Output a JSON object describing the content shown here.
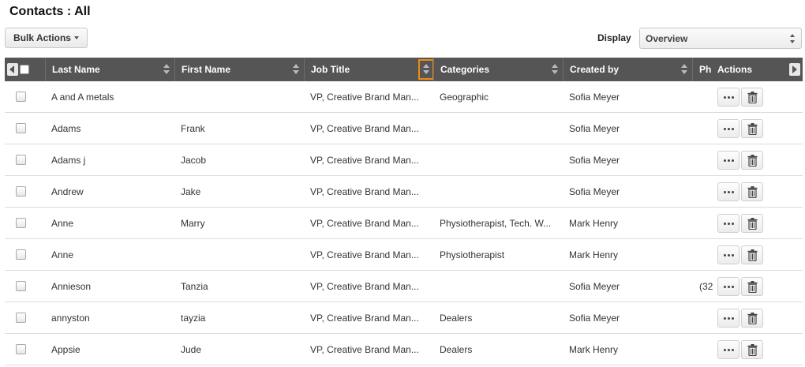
{
  "page": {
    "title": "Contacts : All"
  },
  "toolbar": {
    "bulk_actions_label": "Bulk Actions",
    "display_label": "Display",
    "display_value": "Overview"
  },
  "table": {
    "columns": [
      {
        "key": "last_name",
        "label": "Last Name"
      },
      {
        "key": "first_name",
        "label": "First Name"
      },
      {
        "key": "job_title",
        "label": "Job Title"
      },
      {
        "key": "categories",
        "label": "Categories"
      },
      {
        "key": "created_by",
        "label": "Created by"
      },
      {
        "key": "phone",
        "label": "Ph"
      },
      {
        "key": "actions",
        "label": "Actions"
      }
    ],
    "rows": [
      {
        "last_name": "A and A metals",
        "first_name": "",
        "job_title": "VP, Creative Brand Man...",
        "categories": "Geographic",
        "created_by": "Sofia Meyer",
        "phone": ""
      },
      {
        "last_name": "Adams",
        "first_name": "Frank",
        "job_title": "VP, Creative Brand Man...",
        "categories": "",
        "created_by": "Sofia Meyer",
        "phone": ""
      },
      {
        "last_name": "Adams j",
        "first_name": "Jacob",
        "job_title": "VP, Creative Brand Man...",
        "categories": "",
        "created_by": "Sofia Meyer",
        "phone": ""
      },
      {
        "last_name": "Andrew",
        "first_name": "Jake",
        "job_title": "VP, Creative Brand Man...",
        "categories": "",
        "created_by": "Sofia Meyer",
        "phone": ""
      },
      {
        "last_name": "Anne",
        "first_name": "Marry",
        "job_title": "VP, Creative Brand Man...",
        "categories": "Physiotherapist, Tech. W...",
        "created_by": "Mark Henry",
        "phone": ""
      },
      {
        "last_name": "Anne",
        "first_name": "",
        "job_title": "VP, Creative Brand Man...",
        "categories": "Physiotherapist",
        "created_by": "Mark Henry",
        "phone": ""
      },
      {
        "last_name": "Annieson",
        "first_name": "Tanzia",
        "job_title": "VP, Creative Brand Man...",
        "categories": "",
        "created_by": "Sofia Meyer",
        "phone": "(32"
      },
      {
        "last_name": "annyston",
        "first_name": "tayzia",
        "job_title": "VP, Creative Brand Man...",
        "categories": "Dealers",
        "created_by": "Sofia Meyer",
        "phone": ""
      },
      {
        "last_name": "Appsie",
        "first_name": "Jude",
        "job_title": "VP, Creative Brand Man...",
        "categories": "Dealers",
        "created_by": "Mark Henry",
        "phone": ""
      }
    ]
  },
  "icons": {
    "more": "more-dots-icon",
    "delete": "trash-icon",
    "sort": "sort-updown-icon",
    "scroll_left": "chevron-left-icon",
    "scroll_right": "chevron-right-icon"
  },
  "colors": {
    "header_bg": "#555555",
    "sort_highlight": "#f08a13"
  }
}
